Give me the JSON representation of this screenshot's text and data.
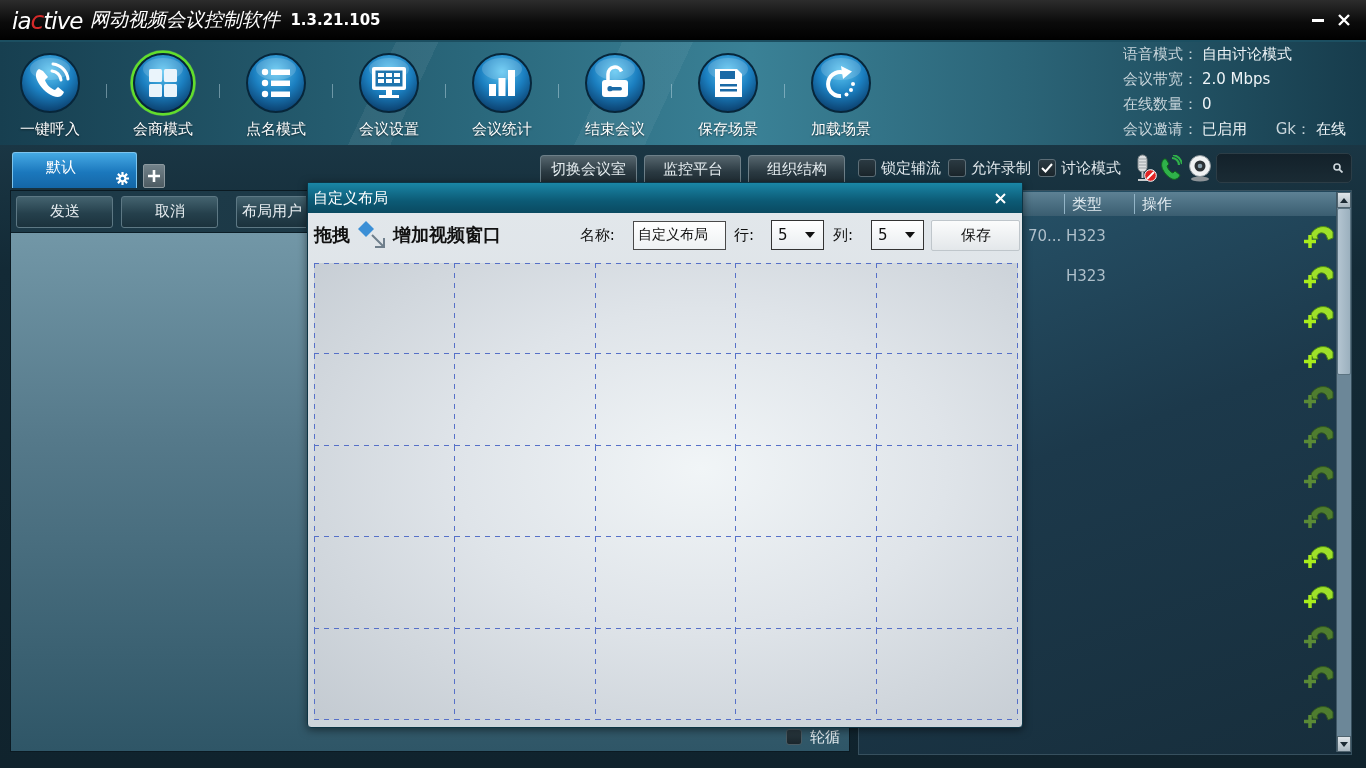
{
  "window": {
    "logo": [
      {
        "text": "ia",
        "color": "#ffffff"
      },
      {
        "text": "c",
        "color": "#d42a2a"
      },
      {
        "text": "tive",
        "color": "#ffffff"
      }
    ],
    "title": "网动视频会议控制软件",
    "version": "1.3.21.105"
  },
  "toolbar": {
    "buttons": [
      {
        "label": "一键呼入",
        "selected": false
      },
      {
        "label": "会商模式",
        "selected": true
      },
      {
        "label": "点名模式",
        "selected": false
      },
      {
        "label": "会议设置",
        "selected": false
      },
      {
        "label": "会议统计",
        "selected": false
      },
      {
        "label": "结束会议",
        "selected": false
      },
      {
        "label": "保存场景",
        "selected": false
      },
      {
        "label": "加载场景",
        "selected": false
      }
    ]
  },
  "status_info": [
    {
      "label": "语音模式：",
      "value": "自由讨论模式"
    },
    {
      "label": "会议带宽：",
      "value": "2.0 Mbps"
    },
    {
      "label": "在线数量：",
      "value": "0"
    },
    {
      "label": "会议邀请：",
      "value": "已启用",
      "extra_label": "Gk：",
      "extra_value": "在线"
    }
  ],
  "tabs": [
    {
      "label": "默认",
      "selected": true
    }
  ],
  "top_buttons": [
    "切换会议室",
    "监控平台",
    "组织结构"
  ],
  "options": [
    {
      "label": "锁定辅流",
      "checked": false
    },
    {
      "label": "允许录制",
      "checked": false
    },
    {
      "label": "讨论模式",
      "checked": true
    }
  ],
  "status_icons": {
    "microphone_muted": true
  },
  "left_panel": {
    "buttons": [
      "发送",
      "取消",
      "布局用户"
    ],
    "rotation": {
      "label": "轮循",
      "checked": false
    }
  },
  "table": {
    "columns": [
      {
        "label": "类型"
      },
      {
        "label": "操作"
      }
    ],
    "rows": [
      {
        "column_1": "70...",
        "type": "H323",
        "call_enabled": true
      },
      {
        "type": "H323",
        "call_enabled": true
      },
      {
        "call_enabled": true
      },
      {
        "call_enabled": true
      },
      {
        "call_enabled": false
      },
      {
        "call_enabled": false
      },
      {
        "call_enabled": false
      },
      {
        "call_enabled": false
      },
      {
        "call_enabled": true
      },
      {
        "call_enabled": true
      },
      {
        "call_enabled": false
      },
      {
        "call_enabled": false
      },
      {
        "call_enabled": false
      }
    ]
  },
  "dialog": {
    "title": "自定义布局",
    "drag_hint": "拖拽",
    "add_window": "增加视频窗口",
    "name_label": "名称:",
    "name_value": "自定义布局",
    "rows_label": "行:",
    "rows_value": "5",
    "columns_label": "列:",
    "columns_value": "5",
    "save_button": "保存"
  }
}
